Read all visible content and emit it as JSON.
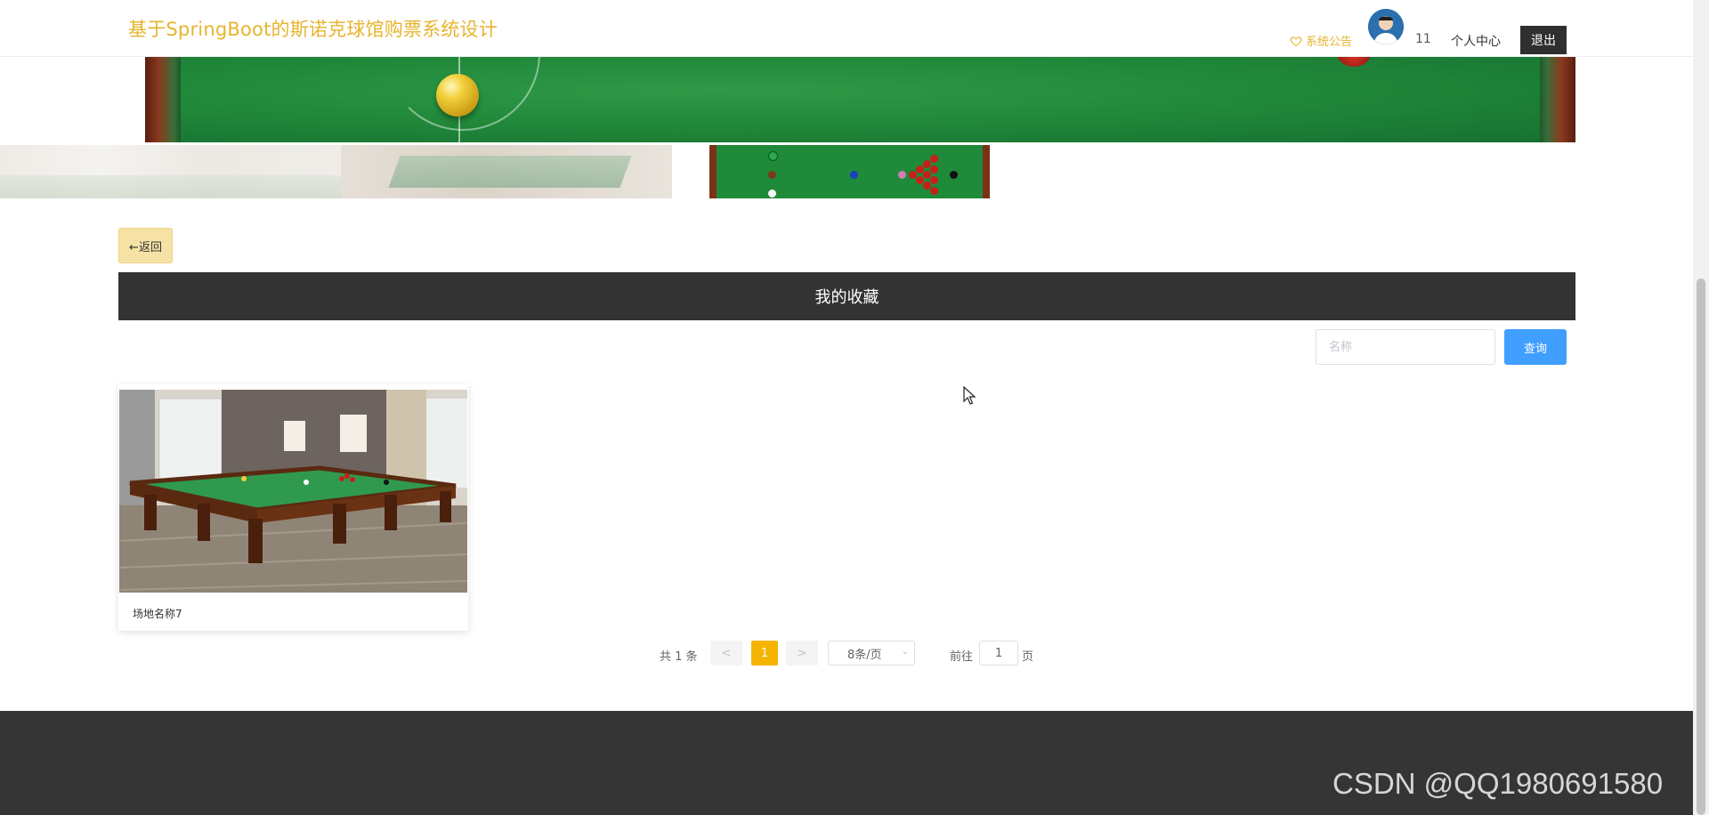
{
  "header": {
    "site_title": "基于SpringBoot的斯诺克球馆购票系统设计",
    "notice_label": "系统公告",
    "username": "11",
    "user_center_label": "个人中心",
    "logout_label": "退出"
  },
  "content": {
    "back_label": "←返回",
    "section_title": "我的收藏",
    "search": {
      "placeholder": "名称",
      "value": ""
    },
    "search_button_label": "查询",
    "cards": [
      {
        "name": "场地名称7"
      }
    ]
  },
  "pagination": {
    "total_text": "共 1 条",
    "prev_label": "<",
    "current_page": "1",
    "next_label": ">",
    "page_size_label": "8条/页",
    "goto_label": "前往",
    "goto_value": "1",
    "goto_unit": "页"
  },
  "watermark": "CSDN @QQ1980691580",
  "colors": {
    "brand": "#e7b42d",
    "dark_bar": "#333333",
    "primary_button": "#409eff",
    "active_page": "#f4b400",
    "footer": "#353535"
  }
}
